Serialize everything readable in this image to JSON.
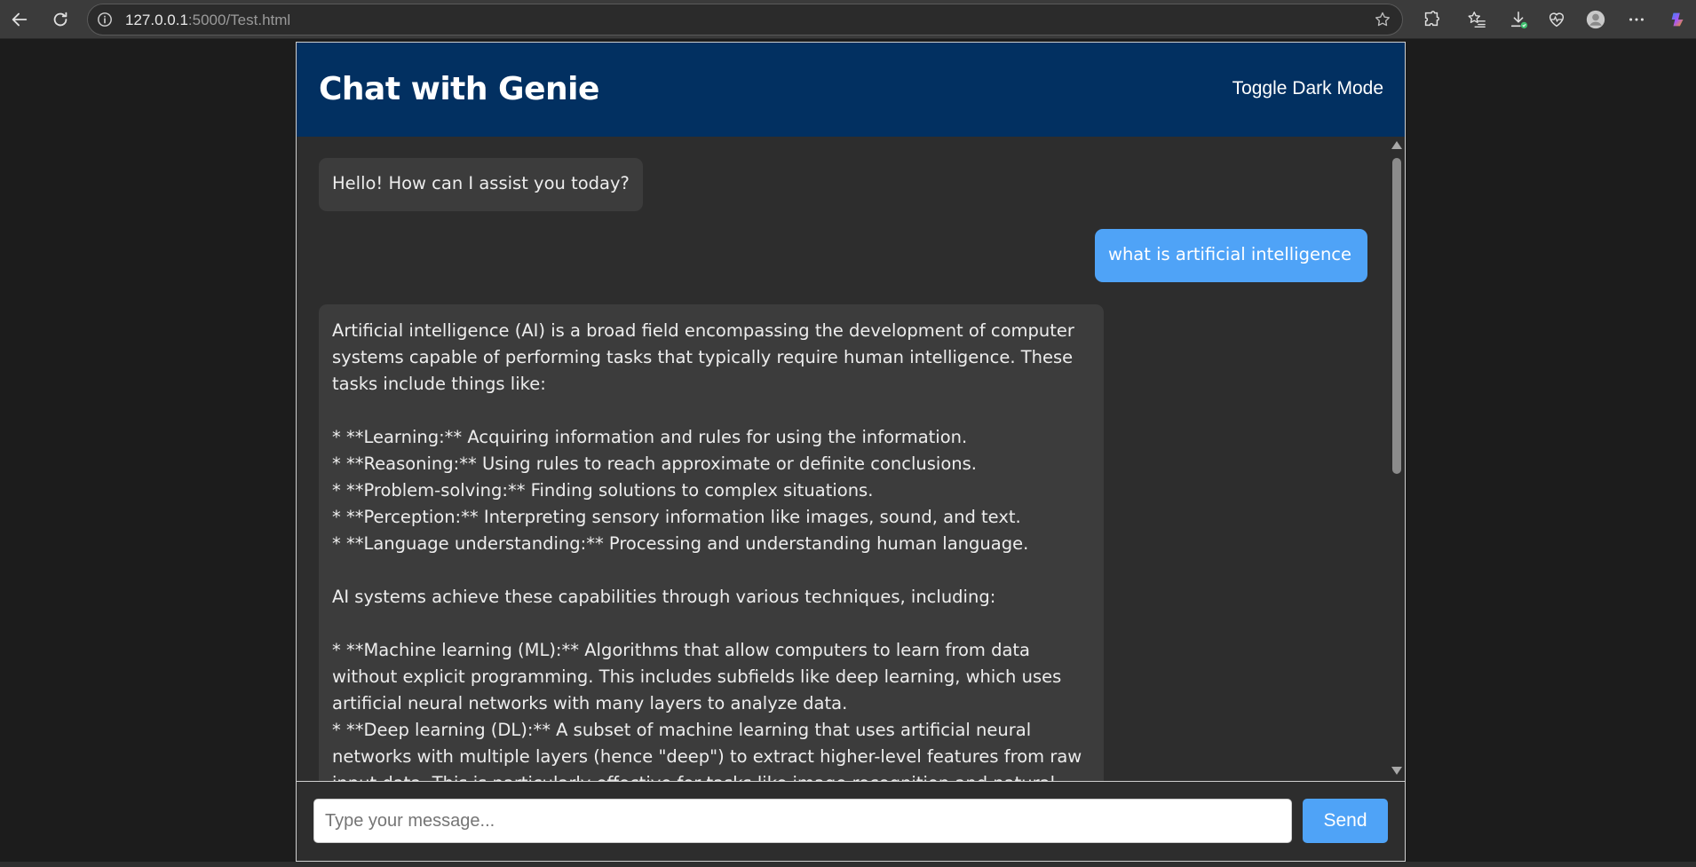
{
  "browser": {
    "url_host": "127.0.0.1",
    "url_path": ":5000/Test.html"
  },
  "chat": {
    "title": "Chat with Genie",
    "toggle_label": "Toggle Dark Mode",
    "messages": [
      {
        "role": "bot",
        "text": "Hello! How can I assist you today?"
      },
      {
        "role": "user",
        "text": "what is artificial intelligence"
      },
      {
        "role": "bot",
        "text": "Artificial intelligence (AI) is a broad field encompassing the development of computer systems capable of performing tasks that typically require human intelligence. These tasks include things like:\n\n* **Learning:** Acquiring information and rules for using the information.\n* **Reasoning:** Using rules to reach approximate or definite conclusions.\n* **Problem-solving:** Finding solutions to complex situations.\n* **Perception:** Interpreting sensory information like images, sound, and text.\n* **Language understanding:** Processing and understanding human language.\n\nAI systems achieve these capabilities through various techniques, including:\n\n* **Machine learning (ML):** Algorithms that allow computers to learn from data without explicit programming. This includes subfields like deep learning, which uses artificial neural networks with many layers to analyze data.\n* **Deep learning (DL):** A subset of machine learning that uses artificial neural networks with multiple layers (hence \"deep\") to extract higher-level features from raw input data. This is particularly effective for tasks like image recognition and natural"
      }
    ],
    "input_placeholder": "Type your message...",
    "send_label": "Send"
  },
  "colors": {
    "header_bg": "#023061",
    "user_bubble": "#4fa3f7",
    "bot_bubble": "#3c3c3c",
    "send_button": "#4fa3f7"
  }
}
